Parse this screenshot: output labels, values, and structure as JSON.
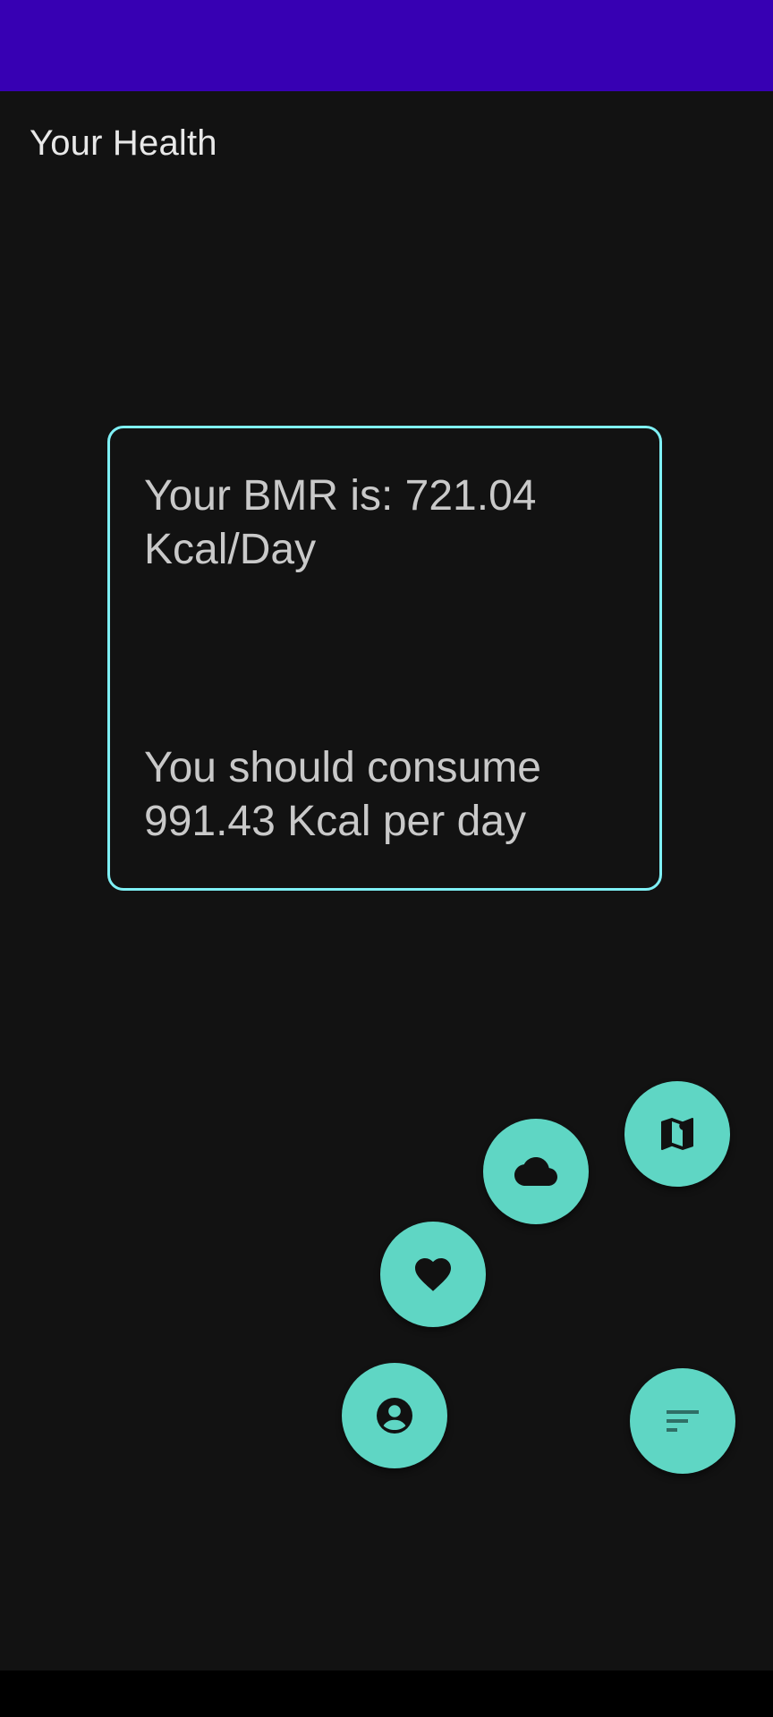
{
  "app": {
    "title": "Your Health"
  },
  "result": {
    "bmr_text": "Your BMR is: 721.04 Kcal/Day",
    "consume_text": "You should consume 991.43 Kcal per day"
  },
  "fabs": [
    {
      "icon": "map-icon"
    },
    {
      "icon": "cloud-icon"
    },
    {
      "icon": "heart-icon"
    },
    {
      "icon": "account-icon"
    },
    {
      "icon": "sort-icon"
    }
  ],
  "colors": {
    "status_bar": "#3700B3",
    "background": "#121212",
    "card_border": "#7ff0f5",
    "fab": "#5fd6c4",
    "text": "#c9c9c9"
  }
}
